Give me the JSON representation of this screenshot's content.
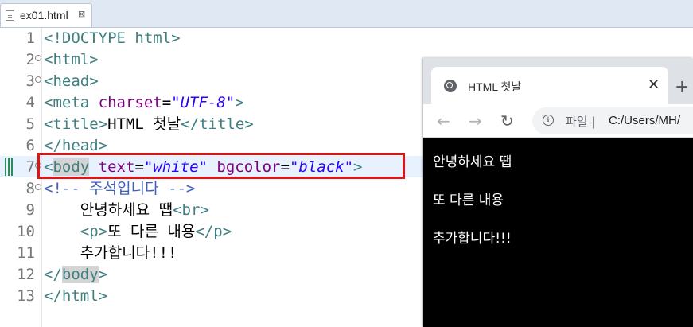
{
  "editor": {
    "tab_title": "ex01.html",
    "tab_close": "⊠",
    "lines": [
      {
        "n": "1",
        "segs": [
          [
            "tag",
            "<!DOCTYPE html>"
          ]
        ]
      },
      {
        "n": "2",
        "segs": [
          [
            "tag",
            "<html>"
          ]
        ]
      },
      {
        "n": "3",
        "segs": [
          [
            "tag",
            "<head>"
          ]
        ]
      },
      {
        "n": "4",
        "segs": [
          [
            "tag",
            "<meta "
          ],
          [
            "attr",
            "charset"
          ],
          [
            "txt",
            "="
          ],
          [
            "val",
            "\"UTF-8\""
          ],
          [
            "tag",
            ">"
          ]
        ]
      },
      {
        "n": "5",
        "segs": [
          [
            "tag",
            "<title>"
          ],
          [
            "txt",
            "HTML 첫날"
          ],
          [
            "tag",
            "</title>"
          ]
        ]
      },
      {
        "n": "6",
        "segs": [
          [
            "tag",
            "</head>"
          ]
        ]
      },
      {
        "n": "7",
        "segs": [
          [
            "tag",
            "<"
          ],
          [
            "tagbody",
            "body"
          ],
          [
            "txt",
            " "
          ],
          [
            "attr",
            "text"
          ],
          [
            "txt",
            "="
          ],
          [
            "val",
            "\"white\""
          ],
          [
            "txt",
            " "
          ],
          [
            "attr",
            "bgcolor"
          ],
          [
            "txt",
            "="
          ],
          [
            "val",
            "\"black\""
          ],
          [
            "tag",
            ">"
          ]
        ]
      },
      {
        "n": "8",
        "segs": [
          [
            "cmt",
            "<!-- 주석입니다 -->"
          ]
        ]
      },
      {
        "n": "9",
        "segs": [
          [
            "txt",
            "    안녕하세요 땝"
          ],
          [
            "tag",
            "<br>"
          ]
        ]
      },
      {
        "n": "10",
        "segs": [
          [
            "txt",
            "    "
          ],
          [
            "tag",
            "<p>"
          ],
          [
            "txt",
            "또 다른 내용"
          ],
          [
            "tag",
            "</p>"
          ]
        ]
      },
      {
        "n": "11",
        "segs": [
          [
            "txt",
            "    추가합니다!!!"
          ]
        ]
      },
      {
        "n": "12",
        "segs": [
          [
            "tag",
            "</"
          ],
          [
            "tagbody",
            "body"
          ],
          [
            "tag",
            ">"
          ]
        ]
      },
      {
        "n": "13",
        "segs": [
          [
            "tag",
            "</html>"
          ]
        ]
      }
    ]
  },
  "browser": {
    "tab_title": "HTML 첫날",
    "tab_close": "✕",
    "new_tab": "+",
    "back": "←",
    "forward": "→",
    "reload": "↻",
    "info": "i",
    "scheme_label": "파일 |",
    "address": "C:/Users/MH/",
    "content": [
      "안녕하세요 땝",
      "또 다른 내용",
      "추가합니다!!!"
    ]
  }
}
